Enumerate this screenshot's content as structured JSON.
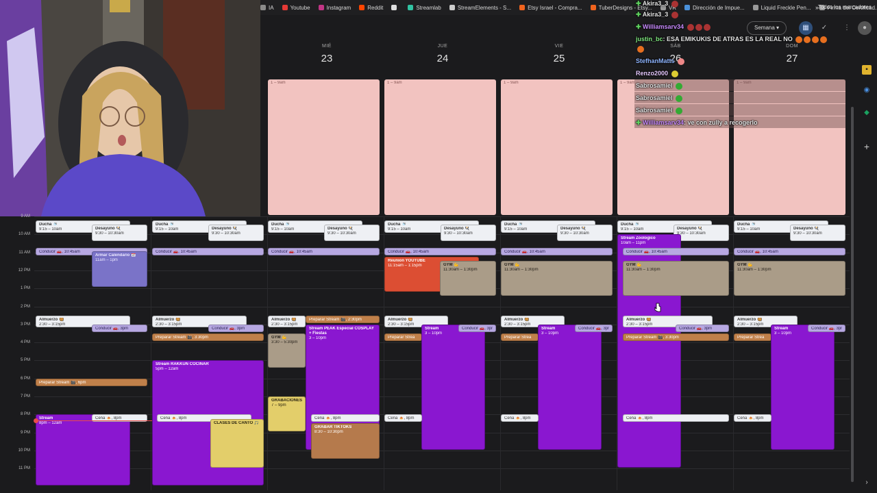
{
  "bookmarks": [
    {
      "label": "IA",
      "color": "#8a8a8a"
    },
    {
      "label": "Youtube",
      "color": "#e53935"
    },
    {
      "label": "Instagram",
      "color": "#c13584"
    },
    {
      "label": "Reddit",
      "color": "#ff4500"
    },
    {
      "label": "",
      "color": "#dddddd"
    },
    {
      "label": "Streamlab",
      "color": "#31c3a2"
    },
    {
      "label": "StreamElements - S...",
      "color": "#cccccc"
    },
    {
      "label": "Etsy Israel - Compra...",
      "color": "#f1641e"
    },
    {
      "label": "TuberDesigns - Etsy...",
      "color": "#f1641e"
    },
    {
      "label": "VR",
      "color": "#999999"
    },
    {
      "label": "Dirección de Impue...",
      "color": "#4a90d9"
    },
    {
      "label": "Liquid Freckle Pen...",
      "color": "#999999"
    },
    {
      "label": "Firma del Certificad...",
      "color": "#999999"
    }
  ],
  "bookmarks_more": "»",
  "bookmarks_all": "Todos los marcadores",
  "topbar": {
    "view_label": "Semana ▾"
  },
  "days": [
    {
      "name": "MIÉ",
      "num": "23"
    },
    {
      "name": "JUE",
      "num": "24"
    },
    {
      "name": "VIE",
      "num": "25"
    },
    {
      "name": "SÁB",
      "num": "26"
    },
    {
      "name": "DOM",
      "num": "27"
    }
  ],
  "times": [
    "9 AM",
    "10 AM",
    "11 AM",
    "12 PM",
    "1 PM",
    "2 PM",
    "3 PM",
    "4 PM",
    "5 PM",
    "6 PM",
    "7 PM",
    "8 PM",
    "9 PM",
    "10 PM",
    "11 PM"
  ],
  "events": {
    "early": "1 – 9am",
    "ducha": {
      "t": "Ducha 🚿",
      "s": "9:15 – 10am"
    },
    "desayuno": {
      "t": "Desayuno 🍳",
      "s": "9:30 – 10:30am"
    },
    "conducir1045": "Conducir 🚗, 10:45am",
    "armar": {
      "t": "Armar Calendario 📅",
      "s": "11am – 1pm"
    },
    "reunion": {
      "t": "Reunion YOUTUBE",
      "s": "11:15am – 1:15pm"
    },
    "gym": {
      "t": "GYM 💪",
      "s": "11:30am – 1:30pm"
    },
    "gym_wed": {
      "t": "GYM 💪",
      "s": "3:30 – 5:30pm"
    },
    "streamzoo": {
      "t": "Stream Zoologico",
      "s": "10am – 11pm"
    },
    "almuerzo": {
      "t": "Almuerzo 🥘",
      "s": "2:30 – 3:15pm"
    },
    "conducir3": "Conducir 🚗, 3pm",
    "prep230": "Preparar Stream 🎬, 2:30pm",
    "prep330": "Preparar Stream 🎬, 3:30pm",
    "prep6": "Preparar Stream 🎬, 6pm",
    "prep_short": "Preparar Strea",
    "peak": {
      "t": "Stream PEAK Especial COSPLAY + Fiestas",
      "s": "3 – 10pm"
    },
    "stream3": {
      "t": "Stream",
      "s": "3 – 10pm"
    },
    "rakkun": {
      "t": "Stream RAKKUN COCINAR",
      "s": "5pm – 12am"
    },
    "stream8": {
      "t": "Stream",
      "s": "8pm – 12am"
    },
    "grabaciones": {
      "t": "GRABACIONES",
      "s": "7 – 9pm"
    },
    "cena": "Cena 🍝, 8pm",
    "canto": "CLASES DE CANTO 🎵",
    "tiktoks": {
      "t": "GRABAR TIKTOKS",
      "s": "8:30 – 10:30pm"
    }
  },
  "chat": [
    {
      "user": "Akira3_3",
      "text": "",
      "color": "#ffffff"
    },
    {
      "user": "Akira3_3",
      "text": "",
      "color": "#ffffff"
    },
    {
      "user": "Williamsarv34",
      "text": "",
      "color": "#c98bff"
    },
    {
      "user": "justin_bc",
      "text": ": ESA EMIKUKIS DE ATRAS ES LA REAL NO",
      "color": "#ffffff"
    },
    {
      "user": "StefhanMatts",
      "text": "",
      "color": "#8fb5ff"
    },
    {
      "user": "Renzo2000",
      "text": "",
      "color": "#ffffff"
    },
    {
      "user": "Sabrosamiel",
      "text": "",
      "color": "#ffffff"
    },
    {
      "user": "Sabrosamiel",
      "text": "",
      "color": "#ffffff"
    },
    {
      "user": "Sabrosamiel",
      "text": "",
      "color": "#ffffff"
    },
    {
      "user": "Williamsarv34",
      "text": ": ve con zully a recogerlo",
      "color": "#c98bff"
    }
  ],
  "side_icons": [
    "plus-icon"
  ]
}
